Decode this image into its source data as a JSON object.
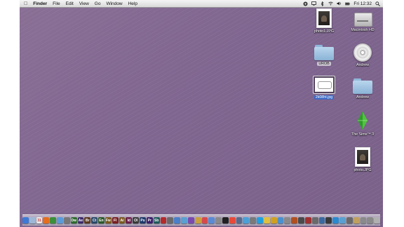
{
  "menubar": {
    "apple": "",
    "app": "Finder",
    "items": [
      "File",
      "Edit",
      "View",
      "Go",
      "Window",
      "Help"
    ],
    "clock": "Fri 12:32"
  },
  "desktop": {
    "icons": [
      {
        "label": "photo1.JPG",
        "type": "photo"
      },
      {
        "label": "Macintosh HD",
        "type": "hd"
      },
      {
        "label": "UROB",
        "type": "folder"
      },
      {
        "label": "Andrew",
        "type": "cd"
      },
      {
        "label": "2k08ht.jpg",
        "type": "doc"
      },
      {
        "label": "Andrew",
        "type": "folder"
      },
      {
        "label": "The Sims™ 3",
        "type": "sims"
      },
      {
        "label": "photo.JPG",
        "type": "photo"
      }
    ]
  },
  "dock": {
    "apps": [
      {
        "icon": "finder-icon",
        "text": "",
        "color": "#3d7ad6"
      },
      {
        "icon": "mail-icon",
        "text": "",
        "color": "#9fb7d6"
      },
      {
        "icon": "calendar-icon",
        "text": "31",
        "color": "#e9e9e9"
      },
      {
        "icon": "firefox-icon",
        "text": "",
        "color": "#e46d1e"
      },
      {
        "icon": "chrome-icon",
        "text": "",
        "color": "#3a8f3a"
      },
      {
        "icon": "safari-icon",
        "text": "",
        "color": "#5a9ad9"
      },
      {
        "icon": "settings-icon",
        "text": "",
        "color": "#777"
      },
      {
        "icon": "dreamweaver-icon",
        "text": "Dw",
        "color": "#2f6b2f"
      },
      {
        "icon": "after-effects-icon",
        "text": "Ae",
        "color": "#3c2a6b"
      },
      {
        "icon": "bridge-icon",
        "text": "Br",
        "color": "#5a3a1f"
      },
      {
        "icon": "contribute-icon",
        "text": "Ct",
        "color": "#2a4a6b"
      },
      {
        "icon": "encore-icon",
        "text": "En",
        "color": "#2a5a2a"
      },
      {
        "icon": "fireworks-icon",
        "text": "Fw",
        "color": "#7a5a1f"
      },
      {
        "icon": "flash-icon",
        "text": "Fl",
        "color": "#7a1f1f"
      },
      {
        "icon": "illustrator-icon",
        "text": "Ai",
        "color": "#7a5a1f"
      },
      {
        "icon": "indesign-icon",
        "text": "Id",
        "color": "#6b1f4a"
      },
      {
        "icon": "onlocation-icon",
        "text": "Ol",
        "color": "#3a3a3a"
      },
      {
        "icon": "photoshop-icon",
        "text": "Ps",
        "color": "#1f3a6b"
      },
      {
        "icon": "premiere-icon",
        "text": "Pr",
        "color": "#3a1f6b"
      },
      {
        "icon": "soundbooth-icon",
        "text": "Sb",
        "color": "#1f5a5a"
      },
      {
        "icon": "photobooth-icon",
        "text": "",
        "color": "#b52a2a"
      },
      {
        "icon": "app-icon",
        "text": "",
        "color": "#6a6a6a"
      },
      {
        "icon": "itunes-icon",
        "text": "",
        "color": "#4a7fc9"
      },
      {
        "icon": "iphoto-icon",
        "text": "",
        "color": "#5aa0d0"
      },
      {
        "icon": "imovie-icon",
        "text": "",
        "color": "#7a4ab0"
      },
      {
        "icon": "garageband-icon",
        "text": "",
        "color": "#c8a040"
      },
      {
        "icon": "ical-icon",
        "text": "",
        "color": "#d84a4a"
      },
      {
        "icon": "app-icon",
        "text": "",
        "color": "#5a8ad6"
      },
      {
        "icon": "app-icon",
        "text": "",
        "color": "#8a8a8a"
      },
      {
        "icon": "dashboard-icon",
        "text": "",
        "color": "#202020"
      },
      {
        "icon": "messenger-icon",
        "text": "",
        "color": "#e84a3a"
      },
      {
        "icon": "app-icon",
        "text": "",
        "color": "#5a6a8a"
      },
      {
        "icon": "twitter-icon",
        "text": "",
        "color": "#4aa0d8"
      },
      {
        "icon": "app-icon",
        "text": "",
        "color": "#7a7a7a"
      },
      {
        "icon": "skype-icon",
        "text": "",
        "color": "#1fa0e0"
      },
      {
        "icon": "app-icon",
        "text": "",
        "color": "#e0c040"
      },
      {
        "icon": "app-icon",
        "text": "",
        "color": "#d0a020"
      },
      {
        "icon": "app-icon",
        "text": "",
        "color": "#4a90d0"
      },
      {
        "icon": "app-icon",
        "text": "",
        "color": "#8a8a8a"
      },
      {
        "icon": "app-icon",
        "text": "",
        "color": "#b05020"
      },
      {
        "icon": "app-icon",
        "text": "",
        "color": "#4a4a4a"
      },
      {
        "icon": "app-icon",
        "text": "",
        "color": "#a03030"
      },
      {
        "icon": "app-icon",
        "text": "",
        "color": "#6a6a6a"
      },
      {
        "icon": "app-icon",
        "text": "",
        "color": "#3a6aa0"
      },
      {
        "icon": "app-icon",
        "text": "",
        "color": "#3a3a3a"
      },
      {
        "icon": "app-icon",
        "text": "",
        "color": "#2a8ad0"
      },
      {
        "icon": "app-icon",
        "text": "",
        "color": "#5aa0d0"
      },
      {
        "icon": "app-icon",
        "text": "",
        "color": "#6a6a6a"
      },
      {
        "icon": "app-icon",
        "text": "",
        "color": "#c0a060"
      },
      {
        "icon": "downloads-icon",
        "text": "",
        "color": "#8a8a8a"
      },
      {
        "icon": "documents-icon",
        "text": "",
        "color": "#8a8a8a"
      },
      {
        "icon": "trash-icon",
        "text": "",
        "color": "#b0b0b0"
      }
    ]
  }
}
